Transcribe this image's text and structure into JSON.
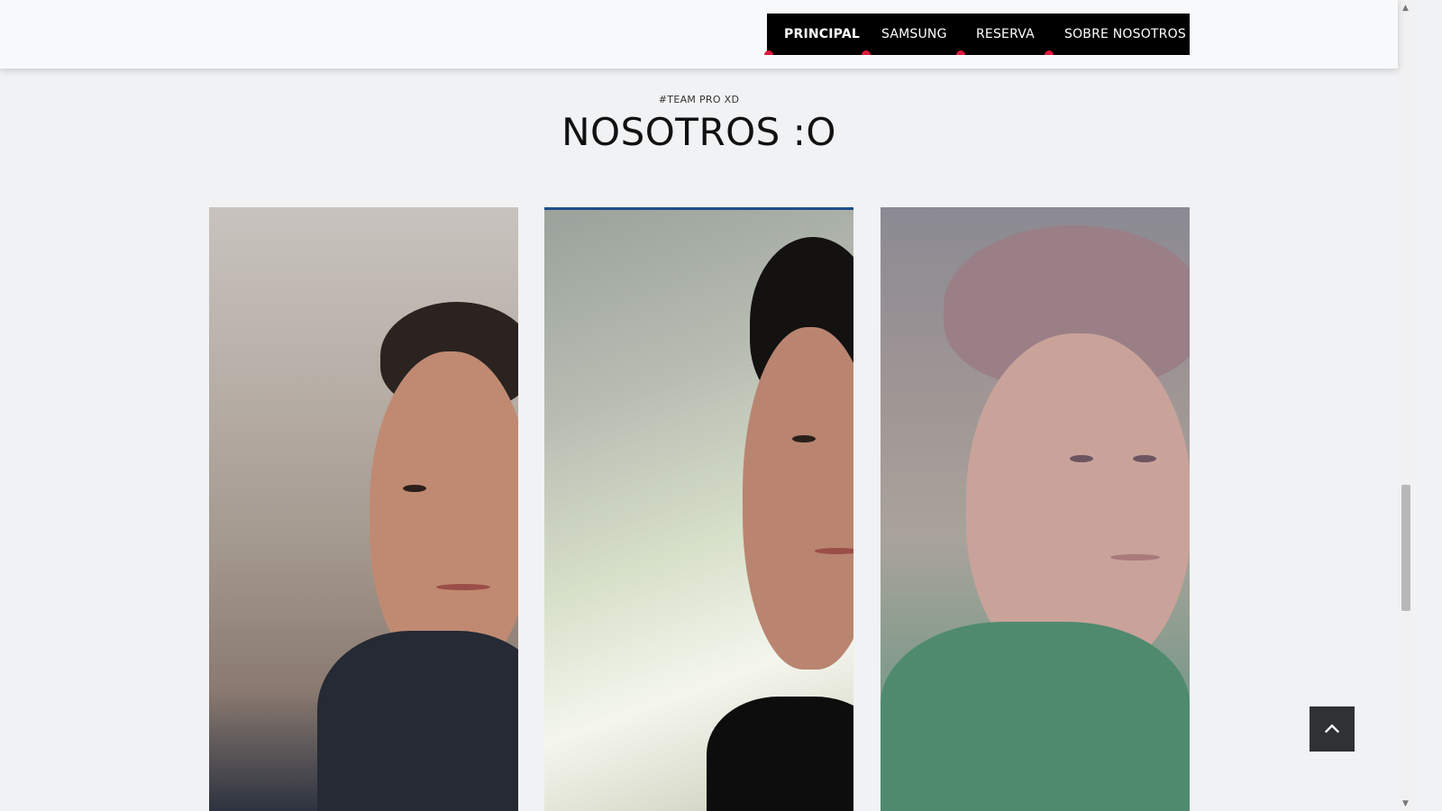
{
  "nav": {
    "items": [
      {
        "label": "PRINCIPAL",
        "active": true
      },
      {
        "label": "SAMSUNG",
        "active": false
      },
      {
        "label": "RESERVA",
        "active": false
      },
      {
        "label": "SOBRE NOSOTROS",
        "active": false
      }
    ]
  },
  "section": {
    "eyebrow": "#TEAM PRO XD",
    "title": "NOSOTROS :O"
  },
  "team_photos": [
    "member-photo-1",
    "member-photo-2",
    "member-photo-3"
  ],
  "colors": {
    "nav_bg": "#000000",
    "accent": "#e0173d",
    "page_bg": "#f1f2f4",
    "back_to_top_bg": "#2f3133"
  },
  "icons": {
    "back_to_top": "chevron-up-icon",
    "scroll_up": "triangle-up-icon",
    "scroll_down": "triangle-down-icon"
  }
}
